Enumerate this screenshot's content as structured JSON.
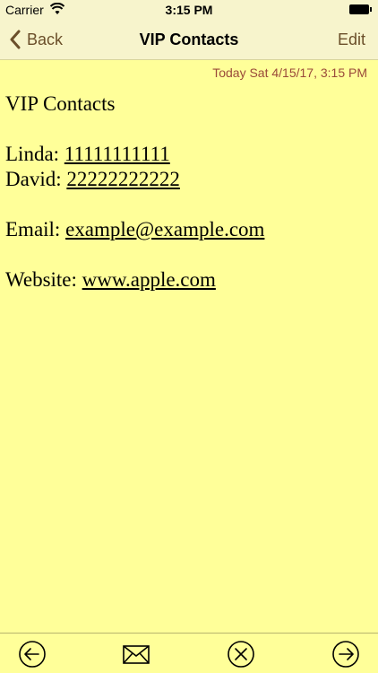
{
  "status": {
    "carrier": "Carrier",
    "time": "3:15 PM"
  },
  "nav": {
    "back_label": "Back",
    "title": "VIP Contacts",
    "edit_label": "Edit"
  },
  "note": {
    "timestamp": "Today Sat  4/15/17, 3:15 PM",
    "heading": "VIP Contacts",
    "linda_label": "Linda: ",
    "linda_phone": "11111111111",
    "david_label": "David: ",
    "david_phone": "22222222222",
    "email_label": "Email: ",
    "email_value": "example@example.com",
    "website_label": "Website: ",
    "website_value": "www.apple.com"
  },
  "toolbar": {
    "icons": [
      "arrow-left-circle-icon",
      "envelope-icon",
      "close-circle-icon",
      "arrow-right-circle-icon"
    ]
  },
  "colors": {
    "background": "#ffff99",
    "bar": "#f7f4cc",
    "accent": "#6b4f2a",
    "timestamp": "#9a4a3a"
  }
}
